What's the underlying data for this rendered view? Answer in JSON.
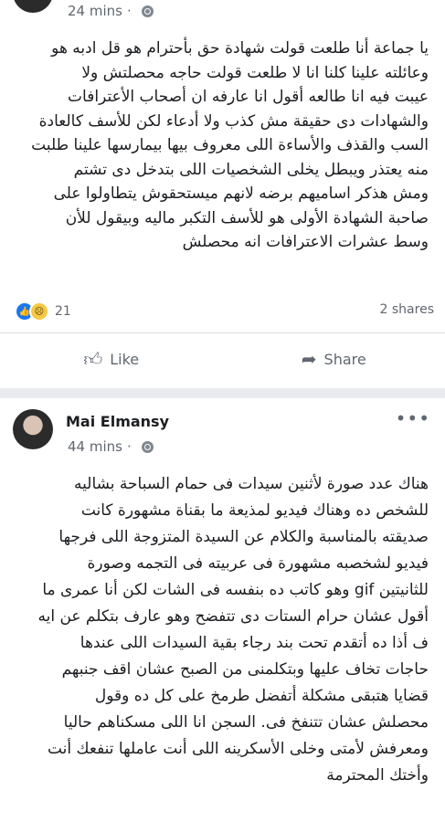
{
  "post1": {
    "time": "24 mins",
    "dot": "·",
    "lines": [
      "يا جماعة أنا طلعت قولت شهادة حق بأحترام هو قل ادبه هو",
      "وعائلته علينا كلنا انا لا طلعت قولت حاجه محصلتش ولا",
      "عيبت فيه انا طالعه أقول انا عارفه ان أصحاب الأعترافات",
      "والشهادات دى حقيقة مش كذب ولا أدعاء لكن للأسف كالعادة",
      "السب والقذف والأساءة اللى معروف بيها بيمارسها علينا طلبت",
      "منه يعتذر ويبطل يخلى الشخصيات اللى بتدخل دى تشتم",
      "ومش هذكر اساميهم برضه لانهم ميستحقوش يتطاولوا على",
      "صاحبة الشهادة الأولى هو للأسف التكبر ماليه وبيقول للأن",
      "وسط عشرات الاعترافات انه محصلش"
    ],
    "reaction_count": "21",
    "shares": "2 shares",
    "like_label": "Like",
    "share_label": "Share"
  },
  "post2": {
    "author": "Mai Elmansy",
    "time": "44 mins",
    "dot": "·",
    "more": "•••",
    "lines": [
      "هناك عدد صورة لأثنين سيدات فى حمام السباحة بشاليه",
      "للشخص ده وهناك فيديو لمذيعة ما بقناة مشهورة كانت",
      "صديقته بالمناسبة والكلام عن السيدة المتزوجة اللى فرجها",
      "فيديو لشخصبه مشهورة فى عربيته فى التجمه وصورة",
      "للثانيتين gif وهو كاتب ده بنفسه فى الشات لكن أنا عمرى ما",
      "أقول عشان حرام الستات دى تتفضح وهو عارف بتكلم عن ايه",
      "ف أذا ده أتقدم تحت بند رجاء بقية السيدات اللى عندها",
      "حاجات تخاف عليها وبتكلمنى من الصبح عشان اقف جنبهم",
      "قضايا هتبقى مشكلة أتفضل طرمخ على كل ده وقول",
      "محصلش عشان تتنفخ فى. السجن انا اللى مسكناهم حاليا",
      "ومعرفش لأمتى وخلى الأسكرينه اللى أنت عاملها تنفعك أنت",
      "وأختك المحترمة"
    ]
  }
}
